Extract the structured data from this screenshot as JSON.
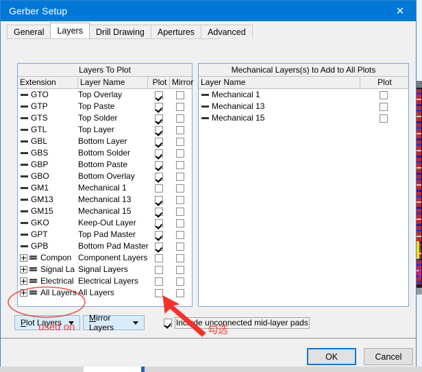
{
  "window": {
    "title": "Gerber Setup",
    "close_icon": "close-icon",
    "titlebar_color": "#0078d7"
  },
  "tabs": [
    {
      "label": "General",
      "active": false
    },
    {
      "label": "Layers",
      "active": true
    },
    {
      "label": "Drill Drawing",
      "active": false
    },
    {
      "label": "Apertures",
      "active": false
    },
    {
      "label": "Advanced",
      "active": false
    }
  ],
  "left_panel": {
    "title": "Layers To Plot",
    "columns": [
      "Extension",
      "Layer Name",
      "Plot",
      "Mirror"
    ],
    "rows": [
      {
        "ext": "GTO",
        "name": "Top Overlay",
        "plot": true,
        "mirror": false,
        "group": false
      },
      {
        "ext": "GTP",
        "name": "Top Paste",
        "plot": true,
        "mirror": false,
        "group": false
      },
      {
        "ext": "GTS",
        "name": "Top Solder",
        "plot": true,
        "mirror": false,
        "group": false
      },
      {
        "ext": "GTL",
        "name": "Top Layer",
        "plot": true,
        "mirror": false,
        "group": false
      },
      {
        "ext": "GBL",
        "name": "Bottom Layer",
        "plot": true,
        "mirror": false,
        "group": false
      },
      {
        "ext": "GBS",
        "name": "Bottom Solder",
        "plot": true,
        "mirror": false,
        "group": false
      },
      {
        "ext": "GBP",
        "name": "Bottom Paste",
        "plot": true,
        "mirror": false,
        "group": false
      },
      {
        "ext": "GBO",
        "name": "Bottom Overlay",
        "plot": true,
        "mirror": false,
        "group": false
      },
      {
        "ext": "GM1",
        "name": "Mechanical 1",
        "plot": false,
        "mirror": false,
        "group": false
      },
      {
        "ext": "GM13",
        "name": "Mechanical 13",
        "plot": true,
        "mirror": false,
        "group": false
      },
      {
        "ext": "GM15",
        "name": "Mechanical 15",
        "plot": true,
        "mirror": false,
        "group": false
      },
      {
        "ext": "GKO",
        "name": "Keep-Out Layer",
        "plot": true,
        "mirror": false,
        "group": false
      },
      {
        "ext": "GPT",
        "name": "Top Pad Master",
        "plot": true,
        "mirror": false,
        "group": false
      },
      {
        "ext": "GPB",
        "name": "Bottom Pad Master",
        "plot": true,
        "mirror": false,
        "group": false
      },
      {
        "ext": "Compon",
        "name": "Component Layers",
        "plot": false,
        "mirror": false,
        "group": true
      },
      {
        "ext": "Signal La",
        "name": "Signal Layers",
        "plot": false,
        "mirror": false,
        "group": true
      },
      {
        "ext": "Electrical",
        "name": "Electrical Layers",
        "plot": false,
        "mirror": false,
        "group": true
      },
      {
        "ext": "All Layers",
        "name": "All Layers",
        "plot": false,
        "mirror": false,
        "group": true
      }
    ]
  },
  "right_panel": {
    "title": "Mechanical Layers(s) to Add to All Plots",
    "columns": [
      "Layer Name",
      "Plot"
    ],
    "rows": [
      {
        "name": "Mechanical 1",
        "plot": false
      },
      {
        "name": "Mechanical 13",
        "plot": false
      },
      {
        "name": "Mechanical 15",
        "plot": false
      }
    ]
  },
  "controls": {
    "plot_layers_button": "Plot Layers",
    "plot_layers_accel": "P",
    "mirror_layers_button": "Mirror Layers",
    "mirror_layers_accel": "M",
    "mid_layer_pads_label": "Include unconnected mid-layer pads",
    "mid_layer_pads_checked": true,
    "dropdown_icon": "chevron-down-icon"
  },
  "footer": {
    "ok_label": "OK",
    "cancel_label": "Cancel",
    "focused_button": "OK"
  },
  "annotations": {
    "color": "#fc3b3b",
    "used_on_text": "used on",
    "chinese_text": "勾选",
    "ellipse_target": "plot-layers-button",
    "arrow_target": "include-unconnected-mid-layer-pads-checkbox"
  }
}
